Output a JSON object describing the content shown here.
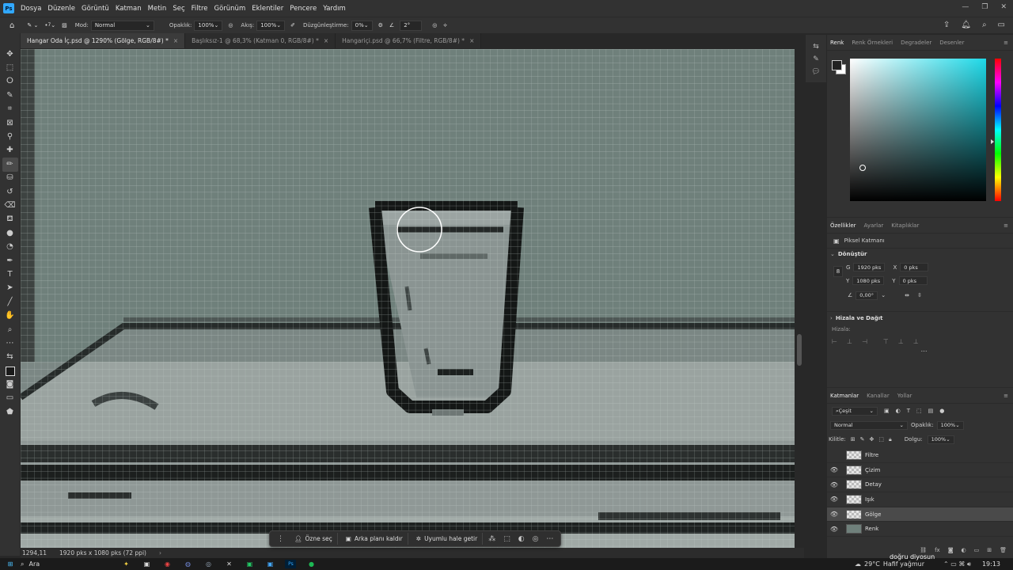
{
  "app": {
    "logo": "Ps"
  },
  "menu": [
    "Dosya",
    "Düzenle",
    "Görüntü",
    "Katman",
    "Metin",
    "Seç",
    "Filtre",
    "Görünüm",
    "Eklentiler",
    "Pencere",
    "Yardım"
  ],
  "options": {
    "mode_label": "Mod:",
    "mode_value": "Normal",
    "opacity_label": "Opaklık:",
    "opacity_value": "100%",
    "flow_label": "Akış:",
    "flow_value": "100%",
    "smoothing_label": "Düzgünleştirme:",
    "smoothing_value": "0%",
    "angle_value": "2°",
    "brush_size": "7"
  },
  "tabs": [
    {
      "label": "Hangar Oda İç.psd @ 1290% (Gölge, RGB/8#) *",
      "active": true
    },
    {
      "label": "Başlıksız-1 @ 68,3% (Katman 0, RGB/8#) *",
      "active": false
    },
    {
      "label": "Hangariçi.psd @ 66,7% (Filtre, RGB/8#) *",
      "active": false
    }
  ],
  "status": {
    "zoom": "1294,11",
    "doc_size": "1920 pks x 1080 pks (72 ppi)"
  },
  "context_bar": {
    "select_subject": "Özne seç",
    "remove_bg": "Arka planı kaldır",
    "harmonize": "Uyumlu hale getir"
  },
  "color_panel": {
    "tabs": [
      "Renk",
      "Renk Örnekleri",
      "Degradeler",
      "Desenler"
    ],
    "active_tab": "Renk",
    "foreground": "#222222",
    "background": "#ffffff",
    "field_hue": "#1ed9e8"
  },
  "properties": {
    "tabs": [
      "Özellikler",
      "Ayarlar",
      "Kitaplıklar"
    ],
    "layer_type": "Piksel Katmanı",
    "transform_label": "Dönüştür",
    "w_label": "G",
    "w_value": "1920 pks",
    "h_label": "Y",
    "h_value": "1080 pks",
    "x_label": "X",
    "x_value": "0 pks",
    "y_label": "Y",
    "y_value": "0 pks",
    "angle_value": "0,00°",
    "align_title": "Hizala ve Dağıt",
    "align_label": "Hizala:"
  },
  "layers_panel": {
    "tabs": [
      "Katmanlar",
      "Kanallar",
      "Yollar"
    ],
    "filter_label": "Çeşit",
    "blend_mode": "Normal",
    "opacity_label": "Opaklık:",
    "opacity_value": "100%",
    "lock_label": "Kilitle:",
    "fill_label": "Dolgu:",
    "fill_value": "100%",
    "layers": [
      {
        "name": "Filtre",
        "visible": false,
        "selected": false
      },
      {
        "name": "Çizim",
        "visible": true,
        "selected": false
      },
      {
        "name": "Detay",
        "visible": true,
        "selected": false
      },
      {
        "name": "Işık",
        "visible": true,
        "selected": false
      },
      {
        "name": "Gölge",
        "visible": true,
        "selected": true
      },
      {
        "name": "Renk",
        "visible": true,
        "selected": false
      }
    ]
  },
  "taskbar": {
    "search_label": "Ara",
    "weather_temp": "29°C",
    "weather_desc": "Hafif yağmur",
    "notification_text": "doğru diyosun",
    "time": "19:13"
  }
}
